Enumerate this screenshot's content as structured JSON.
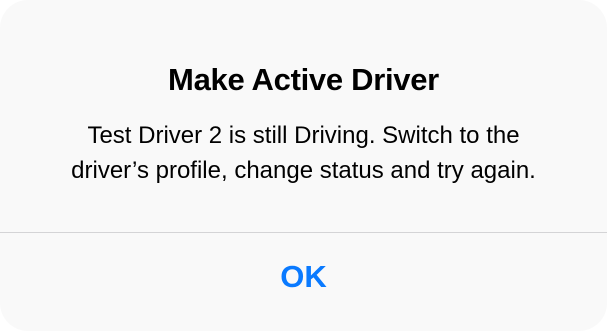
{
  "alert": {
    "title": "Make Active Driver",
    "message_line1": "Test Driver 2 is still Driving. Switch to the",
    "message_line2": "driver’s profile, change status and try again.",
    "ok_label": "OK"
  },
  "colors": {
    "accent": "#0a7aff",
    "background": "#f9f9f9",
    "divider": "#d4d4d6"
  }
}
